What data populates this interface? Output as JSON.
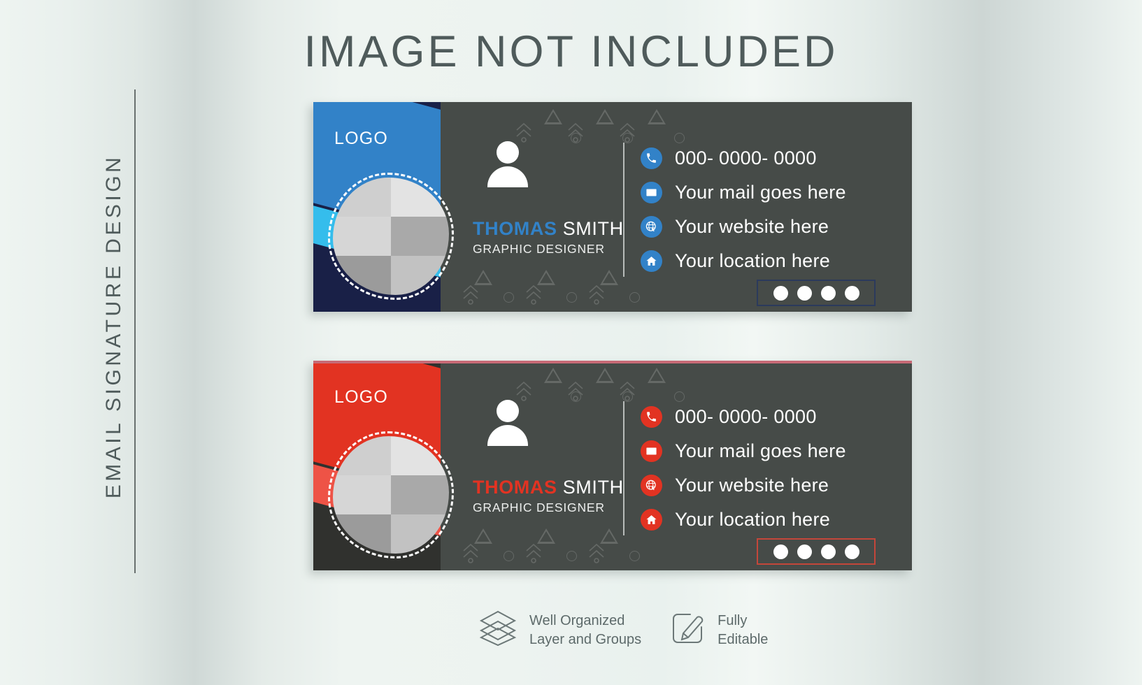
{
  "headline": "IMAGE NOT INCLUDED",
  "vertical_title": "EMAIL SIGNATURE DESIGN",
  "colors": {
    "blue_primary": "#3282c8",
    "blue_accent": "#35bdec",
    "blue_dark": "#192047",
    "red_primary": "#e23322",
    "red_accent": "#ee5346",
    "red_dark": "#30312e",
    "card_bg": "#464b48",
    "page_bg": "#eef4f1",
    "text_muted": "#5d6a6a"
  },
  "cards": [
    {
      "id": "blue",
      "logo": "LOGO",
      "name_first": "THOMAS",
      "name_last": "SMITH",
      "role": "GRAPHIC DESIGNER",
      "contacts": [
        {
          "icon": "phone-icon",
          "text": "000- 0000- 0000"
        },
        {
          "icon": "mail-icon",
          "text": "Your mail goes here"
        },
        {
          "icon": "globe-icon",
          "text": "Your website  here"
        },
        {
          "icon": "home-icon",
          "text": "Your location here"
        }
      ],
      "social_dots": 4
    },
    {
      "id": "red",
      "logo": "LOGO",
      "name_first": "THOMAS",
      "name_last": "SMITH",
      "role": "GRAPHIC DESIGNER",
      "contacts": [
        {
          "icon": "phone-icon",
          "text": "000- 0000- 0000"
        },
        {
          "icon": "mail-icon",
          "text": "Your mail goes here"
        },
        {
          "icon": "globe-icon",
          "text": "Your website  here"
        },
        {
          "icon": "home-icon",
          "text": "Your location here"
        }
      ],
      "social_dots": 4
    }
  ],
  "footer": {
    "features": [
      {
        "icon": "layers-icon",
        "line1": "Well Organized",
        "line2": "Layer and Groups"
      },
      {
        "icon": "pencil-edit-icon",
        "line1": "Fully",
        "line2": "Editable"
      }
    ]
  }
}
